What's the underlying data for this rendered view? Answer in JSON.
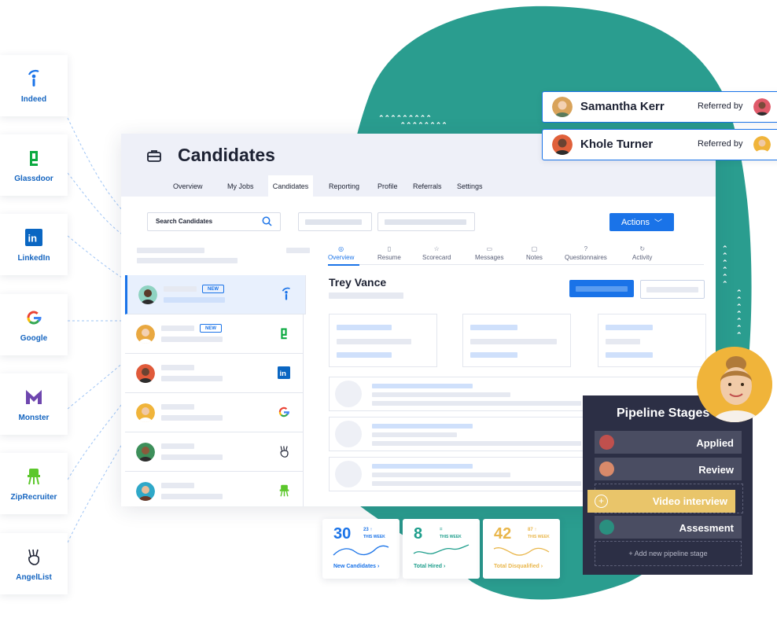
{
  "sources": [
    {
      "label": "Indeed",
      "icon": "indeed-icon"
    },
    {
      "label": "Glassdoor",
      "icon": "glassdoor-icon"
    },
    {
      "label": "LinkedIn",
      "icon": "linkedin-icon"
    },
    {
      "label": "Google",
      "icon": "google-icon"
    },
    {
      "label": "Monster",
      "icon": "monster-icon"
    },
    {
      "label": "ZipRecruiter",
      "icon": "ziprecruiter-icon"
    },
    {
      "label": "AngelList",
      "icon": "angellist-icon"
    }
  ],
  "app": {
    "title": "Candidates",
    "nav": [
      "Overview",
      "My Jobs",
      "Candidates",
      "Reporting",
      "Profile",
      "Referrals",
      "Settings"
    ],
    "active_nav": "Candidates",
    "search_placeholder": "Search Candidates",
    "actions_label": "Actions",
    "candidate_tabs": [
      "Overview",
      "Resume",
      "Scorecard",
      "Messages",
      "Notes",
      "Questionnaires",
      "Activity"
    ],
    "selected_candidate": "Trey Vance",
    "new_badge": "NEW"
  },
  "referrals": [
    {
      "name": "Samantha Kerr",
      "referred_label": "Referred by"
    },
    {
      "name": "Khole Turner",
      "referred_label": "Referred by"
    }
  ],
  "stats": [
    {
      "value": "30",
      "delta": "23",
      "period": "THIS WEEK",
      "label": "New Candidates",
      "color": "#1a73e8"
    },
    {
      "value": "8",
      "delta": "=",
      "period": "THIS WEEK",
      "label": "Total Hired",
      "color": "#1e9e8c"
    },
    {
      "value": "42",
      "delta": "87",
      "period": "THIS WEEK",
      "label": "Total Disqualified",
      "color": "#e9b64a"
    }
  ],
  "pipeline": {
    "title": "Pipeline Stages",
    "stages": [
      {
        "label": "Applied",
        "color": "#c0504d"
      },
      {
        "label": "Review",
        "color": "#d98a6a"
      },
      {
        "label": "Video interview",
        "color": "#e9c56a"
      },
      {
        "label": "Assesment",
        "color": "#2a8f7f"
      }
    ],
    "add_label": "+ Add new pipeline stage"
  },
  "colors": {
    "accent": "#1a73e8",
    "teal_blob": "#2a9d8f",
    "dark_panel": "#2c2f45"
  }
}
